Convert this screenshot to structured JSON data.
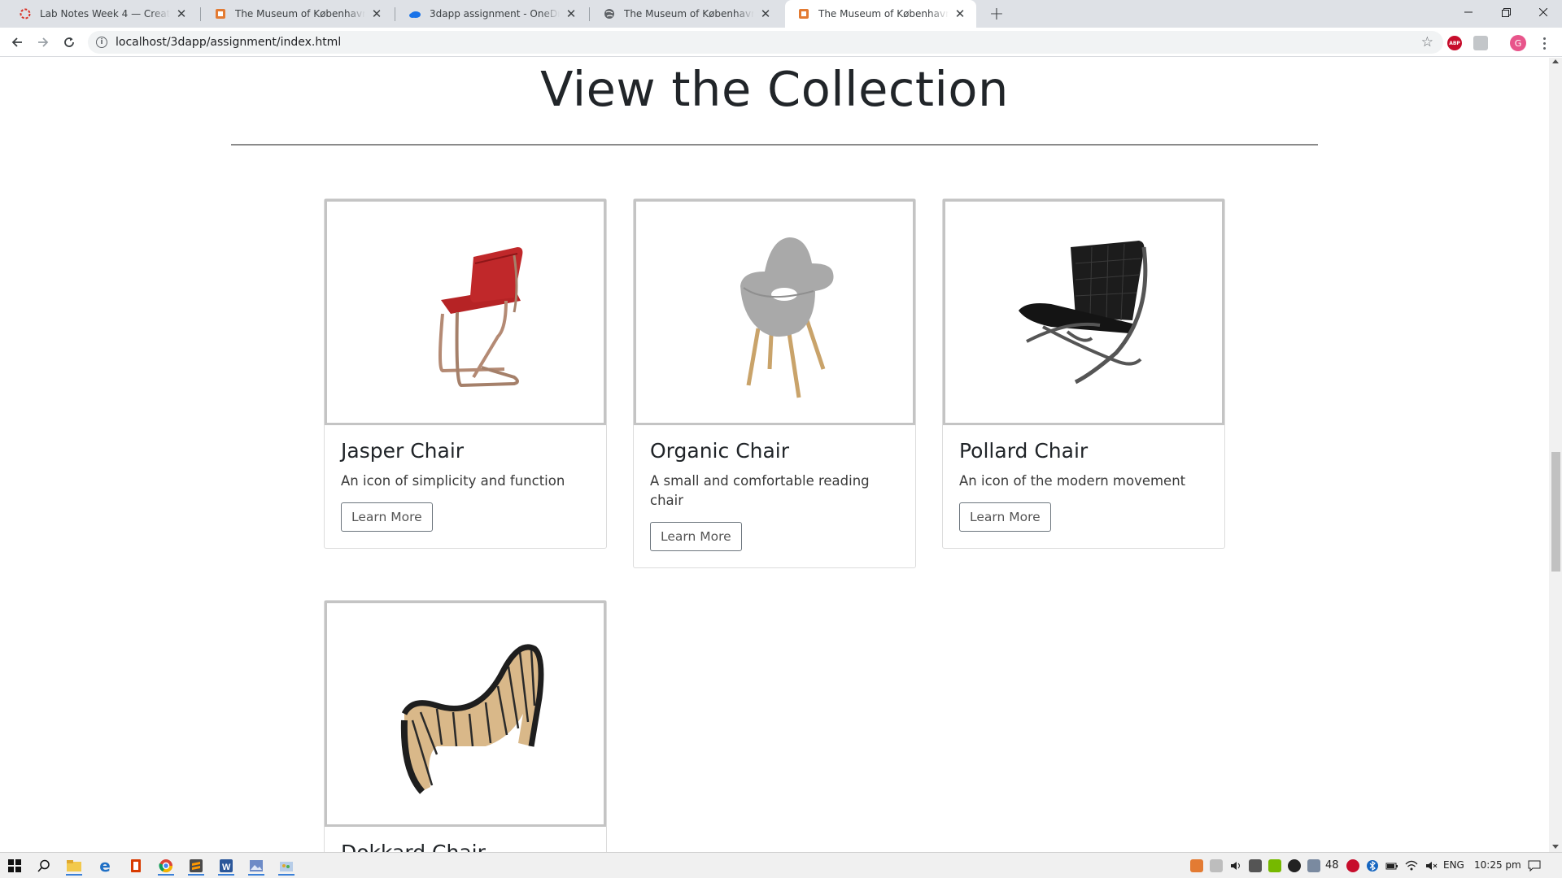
{
  "browser": {
    "tabs": [
      {
        "title": "Lab Notes Week 4 — Create a basic",
        "favicon": "loading-ring-icon",
        "active": false
      },
      {
        "title": "The Museum of København",
        "favicon": "html5-icon",
        "active": false
      },
      {
        "title": "3dapp assignment - OneDrive",
        "favicon": "cloud-icon",
        "active": false
      },
      {
        "title": "The Museum of København",
        "favicon": "globe-icon",
        "active": false
      },
      {
        "title": "The Museum of København",
        "favicon": "html5-icon",
        "active": true
      }
    ],
    "url": "localhost/3dapp/assignment/index.html",
    "profile_initial": "G",
    "extension_abp": "ABP"
  },
  "page": {
    "section_title": "View the Collection",
    "cards": [
      {
        "name": "Jasper Chair",
        "description": "An icon of simplicity and function",
        "button": "Learn More",
        "image": "red-cantilever-chair"
      },
      {
        "name": "Organic Chair",
        "description": "A small and comfortable reading chair",
        "button": "Learn More",
        "image": "grey-organic-chair"
      },
      {
        "name": "Pollard Chair",
        "description": "An icon of the modern movement",
        "button": "Learn More",
        "image": "black-leather-chair"
      },
      {
        "name": "Dokkard Chair",
        "description": "",
        "button": "",
        "image": "wooden-slat-lounger"
      }
    ]
  },
  "taskbar": {
    "tray_count": "48",
    "language": "ENG",
    "time": "10:25 pm"
  },
  "colors": {
    "tab_strip": "#dee1e6",
    "omnibox": "#f1f3f4",
    "heading": "#212529",
    "image_border": "#c4c4c4"
  }
}
